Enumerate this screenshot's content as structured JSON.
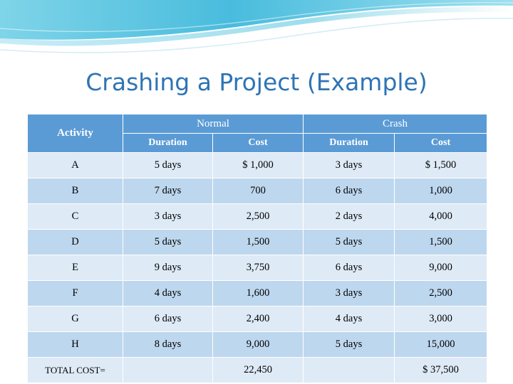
{
  "slide": {
    "title": "Crashing a Project (Example)",
    "title_color": "#2e74b5",
    "header_accent_color": "#41b6d9",
    "table_header_color": "#5b9bd5",
    "row_color_light": "#deeaf6",
    "row_color_dark": "#bdd7ee"
  },
  "table": {
    "header": {
      "activity": "Activity",
      "normal_group": "Normal",
      "crash_group": "Crash",
      "normal_duration": "Duration",
      "normal_cost": "Cost",
      "crash_duration": "Duration",
      "crash_cost": "Cost"
    },
    "rows": [
      {
        "activity": "A",
        "normal_duration": "5 days",
        "normal_cost": "$ 1,000",
        "crash_duration": "3 days",
        "crash_cost": "$ 1,500"
      },
      {
        "activity": "B",
        "normal_duration": "7 days",
        "normal_cost": "700",
        "crash_duration": "6 days",
        "crash_cost": "1,000"
      },
      {
        "activity": "C",
        "normal_duration": "3 days",
        "normal_cost": "2,500",
        "crash_duration": "2 days",
        "crash_cost": "4,000"
      },
      {
        "activity": "D",
        "normal_duration": "5 days",
        "normal_cost": "1,500",
        "crash_duration": "5 days",
        "crash_cost": "1,500"
      },
      {
        "activity": "E",
        "normal_duration": "9 days",
        "normal_cost": "3,750",
        "crash_duration": "6 days",
        "crash_cost": "9,000"
      },
      {
        "activity": "F",
        "normal_duration": "4 days",
        "normal_cost": "1,600",
        "crash_duration": "3 days",
        "crash_cost": "2,500"
      },
      {
        "activity": "G",
        "normal_duration": "6 days",
        "normal_cost": "2,400",
        "crash_duration": "4 days",
        "crash_cost": "3,000"
      },
      {
        "activity": "H",
        "normal_duration": "8 days",
        "normal_cost": "9,000",
        "crash_duration": "5 days",
        "crash_cost": "15,000"
      }
    ],
    "total_row": {
      "activity": "TOTAL COST=",
      "normal_duration": "",
      "normal_cost": "22,450",
      "crash_duration": "",
      "crash_cost": "$ 37,500"
    }
  }
}
